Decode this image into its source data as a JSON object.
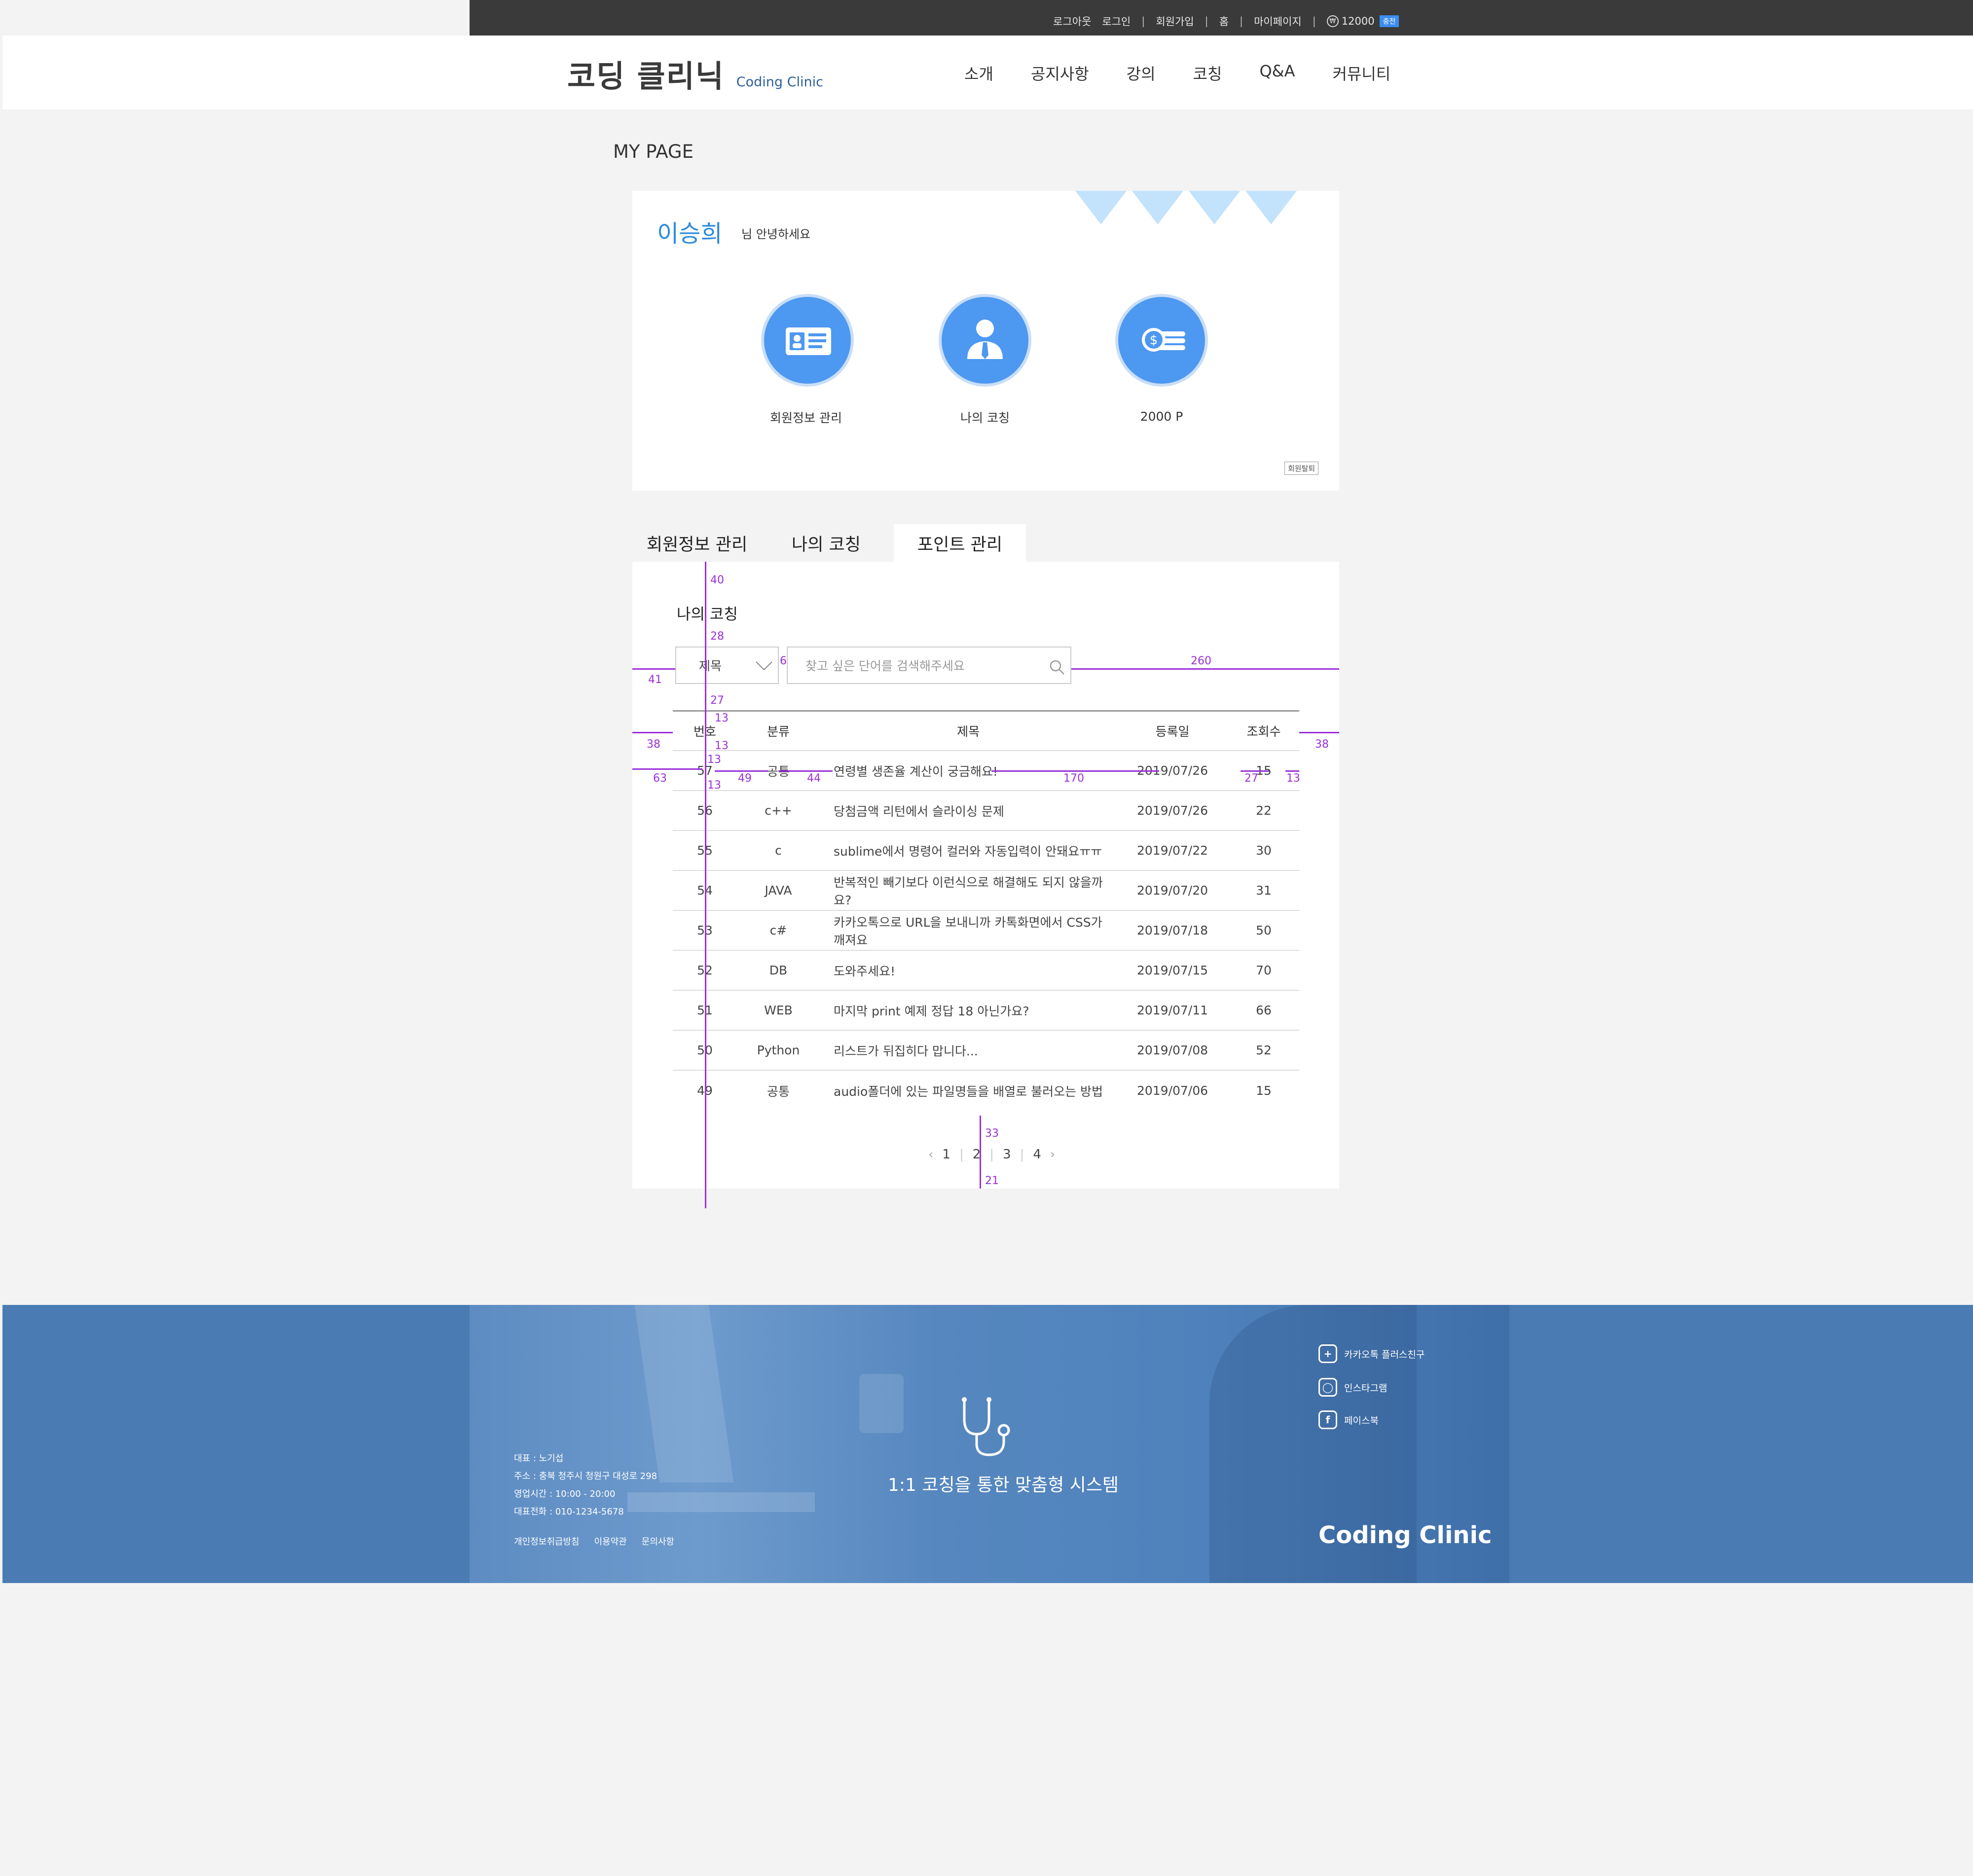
{
  "topbar": {
    "links": [
      "로그아웃",
      "로그인",
      "회원가입",
      "홈",
      "마이페이지"
    ],
    "points": "12000",
    "won_symbol": "₩",
    "charge_label": "충전"
  },
  "header": {
    "logo_ko": "코딩 클리닉",
    "logo_en": "Coding Clinic",
    "nav": [
      "소개",
      "공지사항",
      "강의",
      "코칭",
      "Q&A",
      "커뮤니티"
    ]
  },
  "page_title": "MY PAGE",
  "profile": {
    "username": "이승희",
    "greeting": "님 안녕하세요",
    "items": [
      {
        "label": "회원정보 관리",
        "icon": "id-card-icon"
      },
      {
        "label": "나의 코칭",
        "icon": "person-icon"
      },
      {
        "label": "2000 P",
        "icon": "coins-icon"
      }
    ],
    "withdraw_label": "회원탈퇴"
  },
  "tabs": [
    "회원정보 관리",
    "나의 코칭",
    "포인트 관리"
  ],
  "section_title": "나의 코칭",
  "search": {
    "select_value": "제목",
    "placeholder": "찾고 싶은 단어를 검색해주세요"
  },
  "table": {
    "headers": [
      "번호",
      "분류",
      "제목",
      "등록일",
      "조회수"
    ],
    "rows": [
      [
        "57",
        "공통",
        "연령별 생존율 계산이 궁금해요!",
        "2019/07/26",
        "15"
      ],
      [
        "56",
        "c++",
        "당첨금액 리턴에서 슬라이싱 문제",
        "2019/07/26",
        "22"
      ],
      [
        "55",
        "c",
        "sublime에서 명령어 컬러와 자동입력이 안돼요ㅠㅠ",
        "2019/07/22",
        "30"
      ],
      [
        "54",
        "JAVA",
        "반복적인 빼기보다 이런식으로 해결해도 되지 않을까요?",
        "2019/07/20",
        "31"
      ],
      [
        "53",
        "c#",
        "카카오톡으로 URL을 보내니까 카톡화면에서 CSS가 깨져요",
        "2019/07/18",
        "50"
      ],
      [
        "52",
        "DB",
        "도와주세요!",
        "2019/07/15",
        "70"
      ],
      [
        "51",
        "WEB",
        "마지막 print 예제 정답 18 아닌가요?",
        "2019/07/11",
        "66"
      ],
      [
        "50",
        "Python",
        "리스트가 뒤집히다 맙니다...",
        "2019/07/08",
        "52"
      ],
      [
        "49",
        "공통",
        "audio폴더에 있는 파일명들을 배열로 불러오는 방법",
        "2019/07/06",
        "15"
      ]
    ]
  },
  "pagination": {
    "pages": [
      "1",
      "2",
      "3",
      "4"
    ],
    "prev": "‹",
    "next": "›"
  },
  "guides": {
    "g40": "40",
    "g28": "28",
    "g6": "6",
    "g260": "260",
    "g41": "41",
    "g27": "27",
    "g13a": "13",
    "g38l": "38",
    "g13b": "13",
    "g38r": "38",
    "g13c": "13",
    "g63": "63",
    "g49": "49",
    "g44": "44",
    "g170": "170",
    "g27b": "27",
    "g13d": "13",
    "g13e": "13",
    "g33": "33",
    "g21": "21"
  },
  "footer": {
    "info": [
      "대표 : 노기섭",
      "주소 : 충북 청주시 청원구 대성로 298",
      "영업시간 : 10:00 - 20:00",
      "대표전화 : 010-1234-5678"
    ],
    "links": [
      "개인정보취급방침",
      "이용약관",
      "문의사항"
    ],
    "slogan": "1:1 코칭을 통한 맞춤형 시스템",
    "brand": "Coding Clinic",
    "social": [
      {
        "label": "카카오톡 플러스친구",
        "icon": "kakao-plus-icon"
      },
      {
        "label": "인스타그램",
        "icon": "instagram-icon"
      },
      {
        "label": "페이스북",
        "icon": "facebook-icon"
      }
    ]
  },
  "colors": {
    "accent": "#4d98f0",
    "username": "#2e8bdc",
    "footer_bg": "#4a7cb3",
    "guide": "#9b30d8",
    "pennant": "#c3e2fb"
  }
}
